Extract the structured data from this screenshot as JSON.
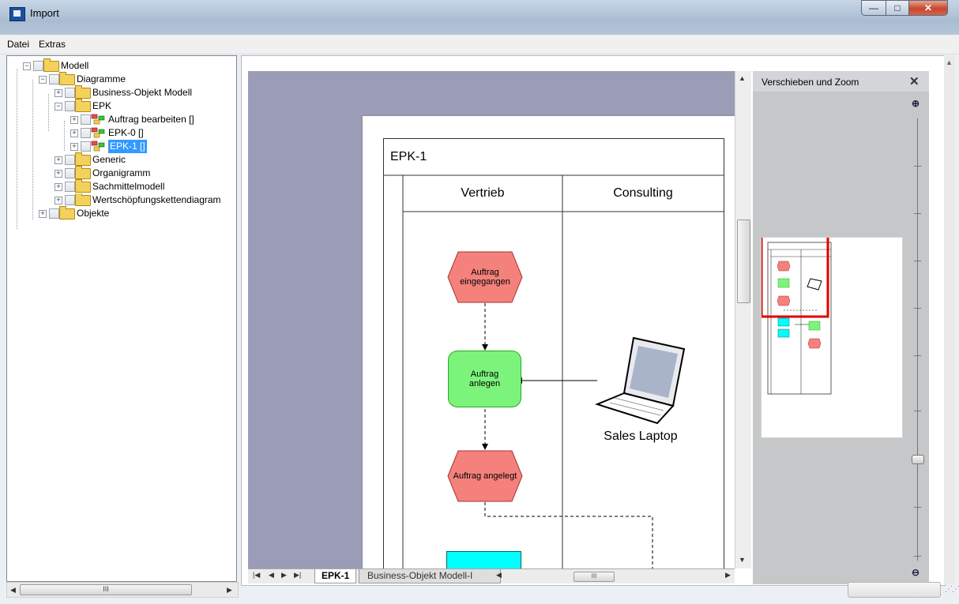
{
  "window": {
    "title": "Import",
    "minimize_glyph": "—",
    "maximize_glyph": "□",
    "close_glyph": "✕"
  },
  "menu": {
    "items": [
      "Datei",
      "Extras"
    ]
  },
  "tree": {
    "items": [
      {
        "label": "Modell",
        "icon": "folder-icon",
        "selected": false
      },
      {
        "label": "Diagramme",
        "icon": "folder-icon",
        "selected": false
      },
      {
        "label": "Business-Objekt Modell",
        "icon": "folder-icon",
        "selected": false
      },
      {
        "label": "EPK",
        "icon": "folder-icon",
        "selected": false
      },
      {
        "label": "Auftrag bearbeiten []",
        "icon": "diagram-icon",
        "selected": false
      },
      {
        "label": "EPK-0 []",
        "icon": "diagram-icon",
        "selected": false
      },
      {
        "label": "EPK-1 []",
        "icon": "diagram-icon",
        "selected": true
      },
      {
        "label": "Generic",
        "icon": "folder-icon",
        "selected": false
      },
      {
        "label": "Organigramm",
        "icon": "folder-icon",
        "selected": false
      },
      {
        "label": "Sachmittelmodell",
        "icon": "folder-icon",
        "selected": false
      },
      {
        "label": "Wertschöpfungskettendiagram",
        "icon": "folder-icon",
        "selected": false
      },
      {
        "label": "Objekte",
        "icon": "folder-icon",
        "selected": false
      }
    ],
    "scrollbar_thumb": "III"
  },
  "diagram": {
    "pool_title": "EPK-1",
    "lanes": [
      "Vertrieb",
      "Consulting"
    ],
    "shapes": {
      "event1": "Auftrag eingegangen",
      "function1": "Auftrag anlegen",
      "event2": "Auftrag angelegt",
      "resource": "Sales Laptop"
    },
    "colors": {
      "event": "#f4817b",
      "function": "#7cf47c",
      "cyan_box": "#00ffff",
      "canvas_bg": "#9b9db6"
    }
  },
  "sheets": {
    "active": "EPK-1",
    "inactive": "Business-Objekt Modell-I",
    "h_thumb": "III"
  },
  "zoom_panel": {
    "title": "Verschieben und Zoom",
    "close": "✕",
    "zoom_in": "⊕",
    "zoom_out": "⊖",
    "slider_level_fraction": 0.8,
    "viewport_color": "#e00000"
  }
}
